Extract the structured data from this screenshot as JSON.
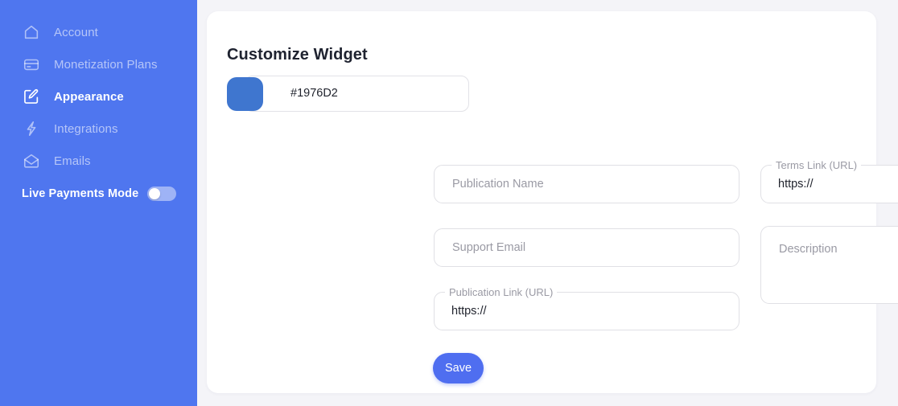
{
  "theme": {
    "sidebar_bg": "#4F76EF",
    "page_bg": "#F4F4F8",
    "card_bg": "#FFFFFF",
    "accent": "#4F6EF0",
    "swatch_color": "#3F76CF",
    "title_color": "#1F2330",
    "placeholder_color": "#9A9AA4",
    "field_border": "#E0E0E5"
  },
  "sidebar": {
    "items": [
      {
        "label": "Account",
        "icon": "home-icon",
        "active": false
      },
      {
        "label": "Monetization Plans",
        "icon": "credit-card-icon",
        "active": false
      },
      {
        "label": "Appearance",
        "icon": "edit-square-icon",
        "active": true
      },
      {
        "label": "Integrations",
        "icon": "lightning-bolt-icon",
        "active": false
      },
      {
        "label": "Emails",
        "icon": "open-envelope-icon",
        "active": false
      }
    ],
    "live_payments": {
      "label": "Live Payments Mode",
      "toggle_state": "off",
      "toggle_name": "live-payments-mode-toggle"
    }
  },
  "main": {
    "title": "Customize Widget",
    "color_field": {
      "value": "#1976D2",
      "placeholder": "#1976D2",
      "swatch_name": "brand-color-swatch"
    },
    "fields": {
      "publication_name": {
        "placeholder": "Publication Name",
        "value": ""
      },
      "terms_link": {
        "label": "Terms Link (URL)",
        "value": "https://"
      },
      "support_email": {
        "placeholder": "Support Email",
        "value": ""
      },
      "description": {
        "placeholder": "Description",
        "value": ""
      },
      "publication_link": {
        "label": "Publication Link (URL)",
        "value": "https://"
      }
    },
    "save_label": "Save"
  }
}
